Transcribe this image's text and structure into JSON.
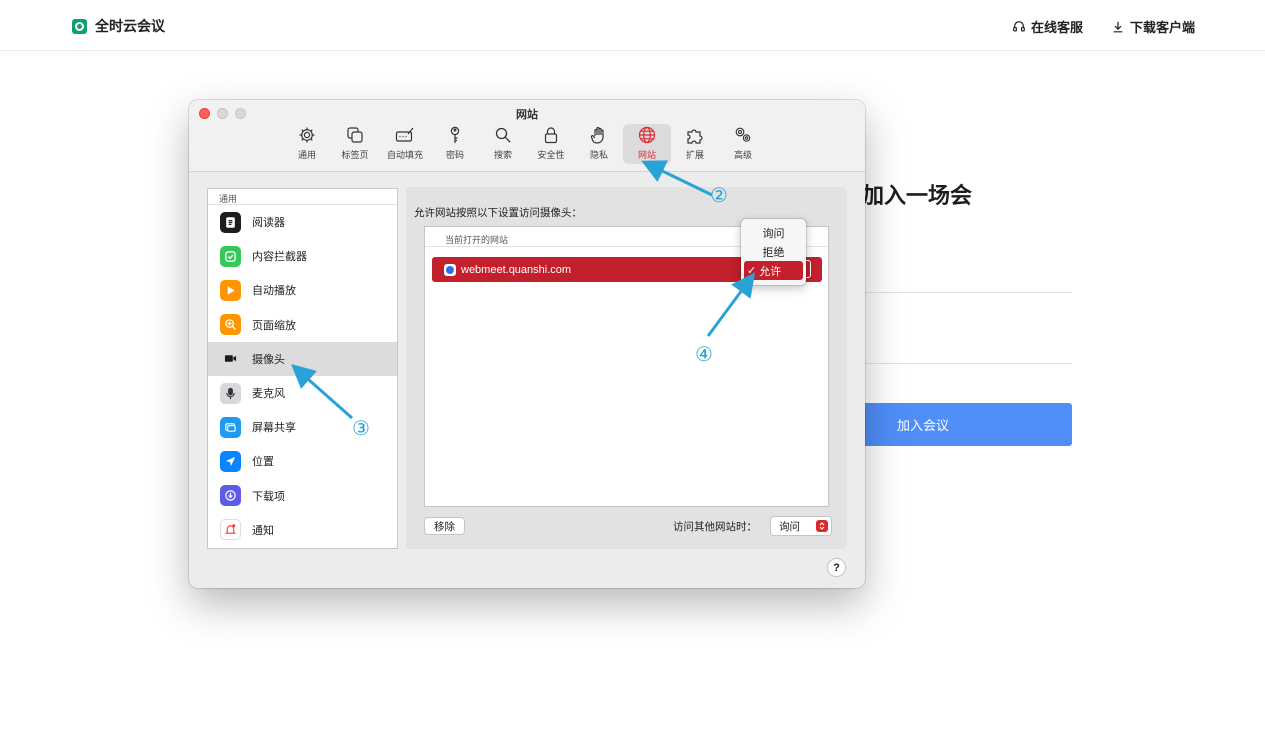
{
  "brand": {
    "name": "全时云会议"
  },
  "topnav": {
    "service": "在线客服",
    "download": "下载客户端"
  },
  "join": {
    "title": "加入一场会",
    "button": "加入会议"
  },
  "window": {
    "title": "网站",
    "toolbar": [
      {
        "label": "通用",
        "icon": "gear-icon"
      },
      {
        "label": "标签页",
        "icon": "tabs-icon"
      },
      {
        "label": "自动填充",
        "icon": "autofill-icon"
      },
      {
        "label": "密码",
        "icon": "key-icon"
      },
      {
        "label": "搜索",
        "icon": "search-icon"
      },
      {
        "label": "安全性",
        "icon": "lock-icon"
      },
      {
        "label": "隐私",
        "icon": "hand-icon"
      },
      {
        "label": "网站",
        "icon": "globe-icon"
      },
      {
        "label": "扩展",
        "icon": "puzzle-icon"
      },
      {
        "label": "高级",
        "icon": "gears-icon"
      }
    ],
    "sidebar": {
      "header": "通用",
      "items": [
        {
          "label": "阅读器",
          "icon": "reader-icon",
          "color": "#1d1d1f"
        },
        {
          "label": "内容拦截器",
          "icon": "shield-check-icon",
          "color": "#34c759"
        },
        {
          "label": "自动播放",
          "icon": "play-icon",
          "color": "#ff9500"
        },
        {
          "label": "页面缩放",
          "icon": "zoom-icon",
          "color": "#ff9500"
        },
        {
          "label": "摄像头",
          "icon": "camera-icon",
          "color": "#1d1d1f"
        },
        {
          "label": "麦克风",
          "icon": "microphone-icon",
          "color": "#8e8e93"
        },
        {
          "label": "屏幕共享",
          "icon": "screen-share-icon",
          "color": "#1e9bf0"
        },
        {
          "label": "位置",
          "icon": "location-icon",
          "color": "#0a84ff"
        },
        {
          "label": "下载项",
          "icon": "download-icon",
          "color": "#5e5ce6"
        },
        {
          "label": "通知",
          "icon": "bell-icon",
          "color": "#ff3b30"
        }
      ]
    },
    "pane": {
      "label": "允许网站按照以下设置访问摄像头：",
      "table_header": "当前打开的网站",
      "site": "webmeet.quanshi.com",
      "remove": "移除",
      "other_label": "访问其他网站时：",
      "other_value": "询问",
      "help": "?"
    },
    "popup": {
      "options": [
        "询问",
        "拒绝",
        "允许"
      ],
      "selected": "允许",
      "check": "✓"
    }
  },
  "annotations": {
    "step2": "②",
    "step3": "③",
    "step4": "④"
  },
  "accent": "#c1202c"
}
